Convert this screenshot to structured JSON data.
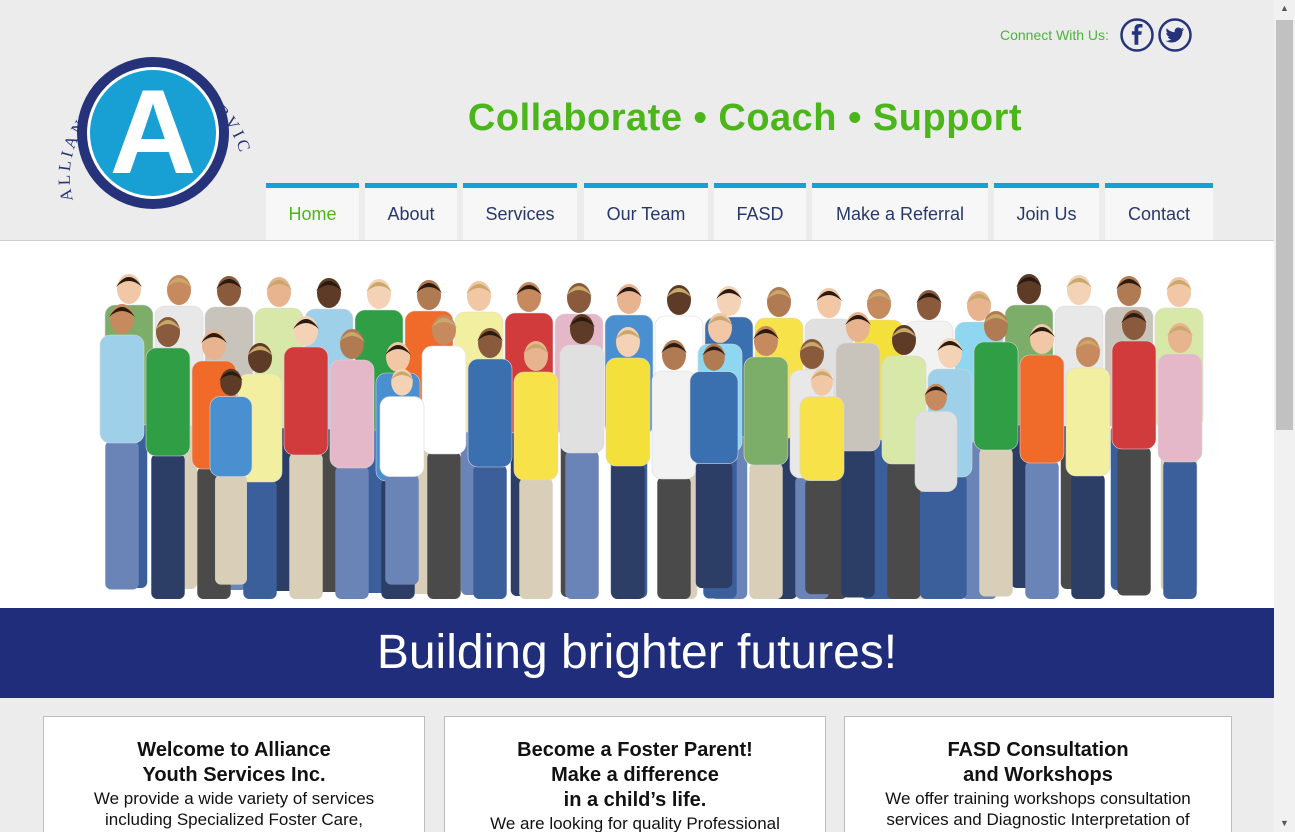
{
  "header": {
    "logo_text": "ALLIANCE YOUTH SERVICES Inc.",
    "logo_letter": "A",
    "connect_label": "Connect With Us:",
    "tagline": "Collaborate • Coach • Support"
  },
  "social": [
    {
      "name": "facebook",
      "icon": "facebook-icon",
      "glyph": "f"
    },
    {
      "name": "twitter",
      "icon": "twitter-icon"
    }
  ],
  "nav": {
    "items": [
      "Home",
      "About",
      "Services",
      "Our Team",
      "FASD",
      "Make a Referral",
      "Join Us",
      "Contact"
    ],
    "active": "Home"
  },
  "banner": {
    "text": "Building brighter futures!"
  },
  "cards": [
    {
      "title_lines": [
        "Welcome to Alliance",
        "Youth Services Inc."
      ],
      "body_lines": [
        "We provide a wide variety of services",
        "including Specialized Foster Care,"
      ]
    },
    {
      "title_lines": [
        "Become a Foster Parent!",
        "Make a difference",
        "in a child’s life."
      ],
      "body_lines": [
        "We are looking for quality Professional"
      ]
    },
    {
      "title_lines": [
        "FASD Consultation",
        "and Workshops"
      ],
      "body_lines": [
        "We offer training workshops consultation",
        "services and Diagnostic Interpretation of"
      ]
    }
  ],
  "colors": {
    "green": "#4bb61a",
    "navy": "#1f2d7a",
    "nav_accent": "#18a0d4",
    "logo_blue": "#18a0d4",
    "logo_ring": "#26337a"
  }
}
